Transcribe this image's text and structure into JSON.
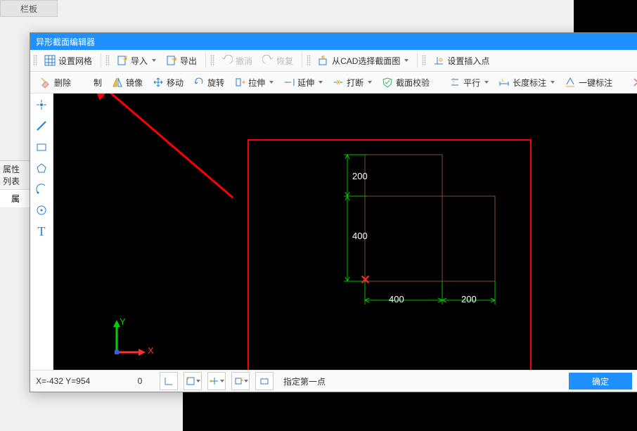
{
  "bg": {
    "tab_label": "栏板"
  },
  "side": {
    "prop_list_title": "属性列表",
    "prop_col": "属"
  },
  "window": {
    "title": "异形截面编辑器"
  },
  "toolbar1": {
    "set_grid": "设置网格",
    "import": "导入",
    "export": "导出",
    "undo": "撤消",
    "redo": "恢复",
    "from_cad": "从CAD选择截面图",
    "set_insert": "设置插入点"
  },
  "toolbar2": {
    "delete": "删除",
    "copy": "制",
    "mirror": "镜像",
    "move": "移动",
    "rotate": "旋转",
    "stretch": "拉伸",
    "extend": "延伸",
    "break": "打断",
    "verify": "截面校验",
    "parallel": "平行",
    "length_dim": "长度标注",
    "auto_dim": "一键标注",
    "more": "删"
  },
  "canvas": {
    "dim_top": "200",
    "dim_mid": "400",
    "dim_bot_left": "400",
    "dim_bot_right": "200",
    "axis_x": "X",
    "axis_y": "Y"
  },
  "status": {
    "coords": "X=-432 Y=954",
    "zero": "0",
    "prompt": "指定第一点",
    "ok": "确定"
  }
}
